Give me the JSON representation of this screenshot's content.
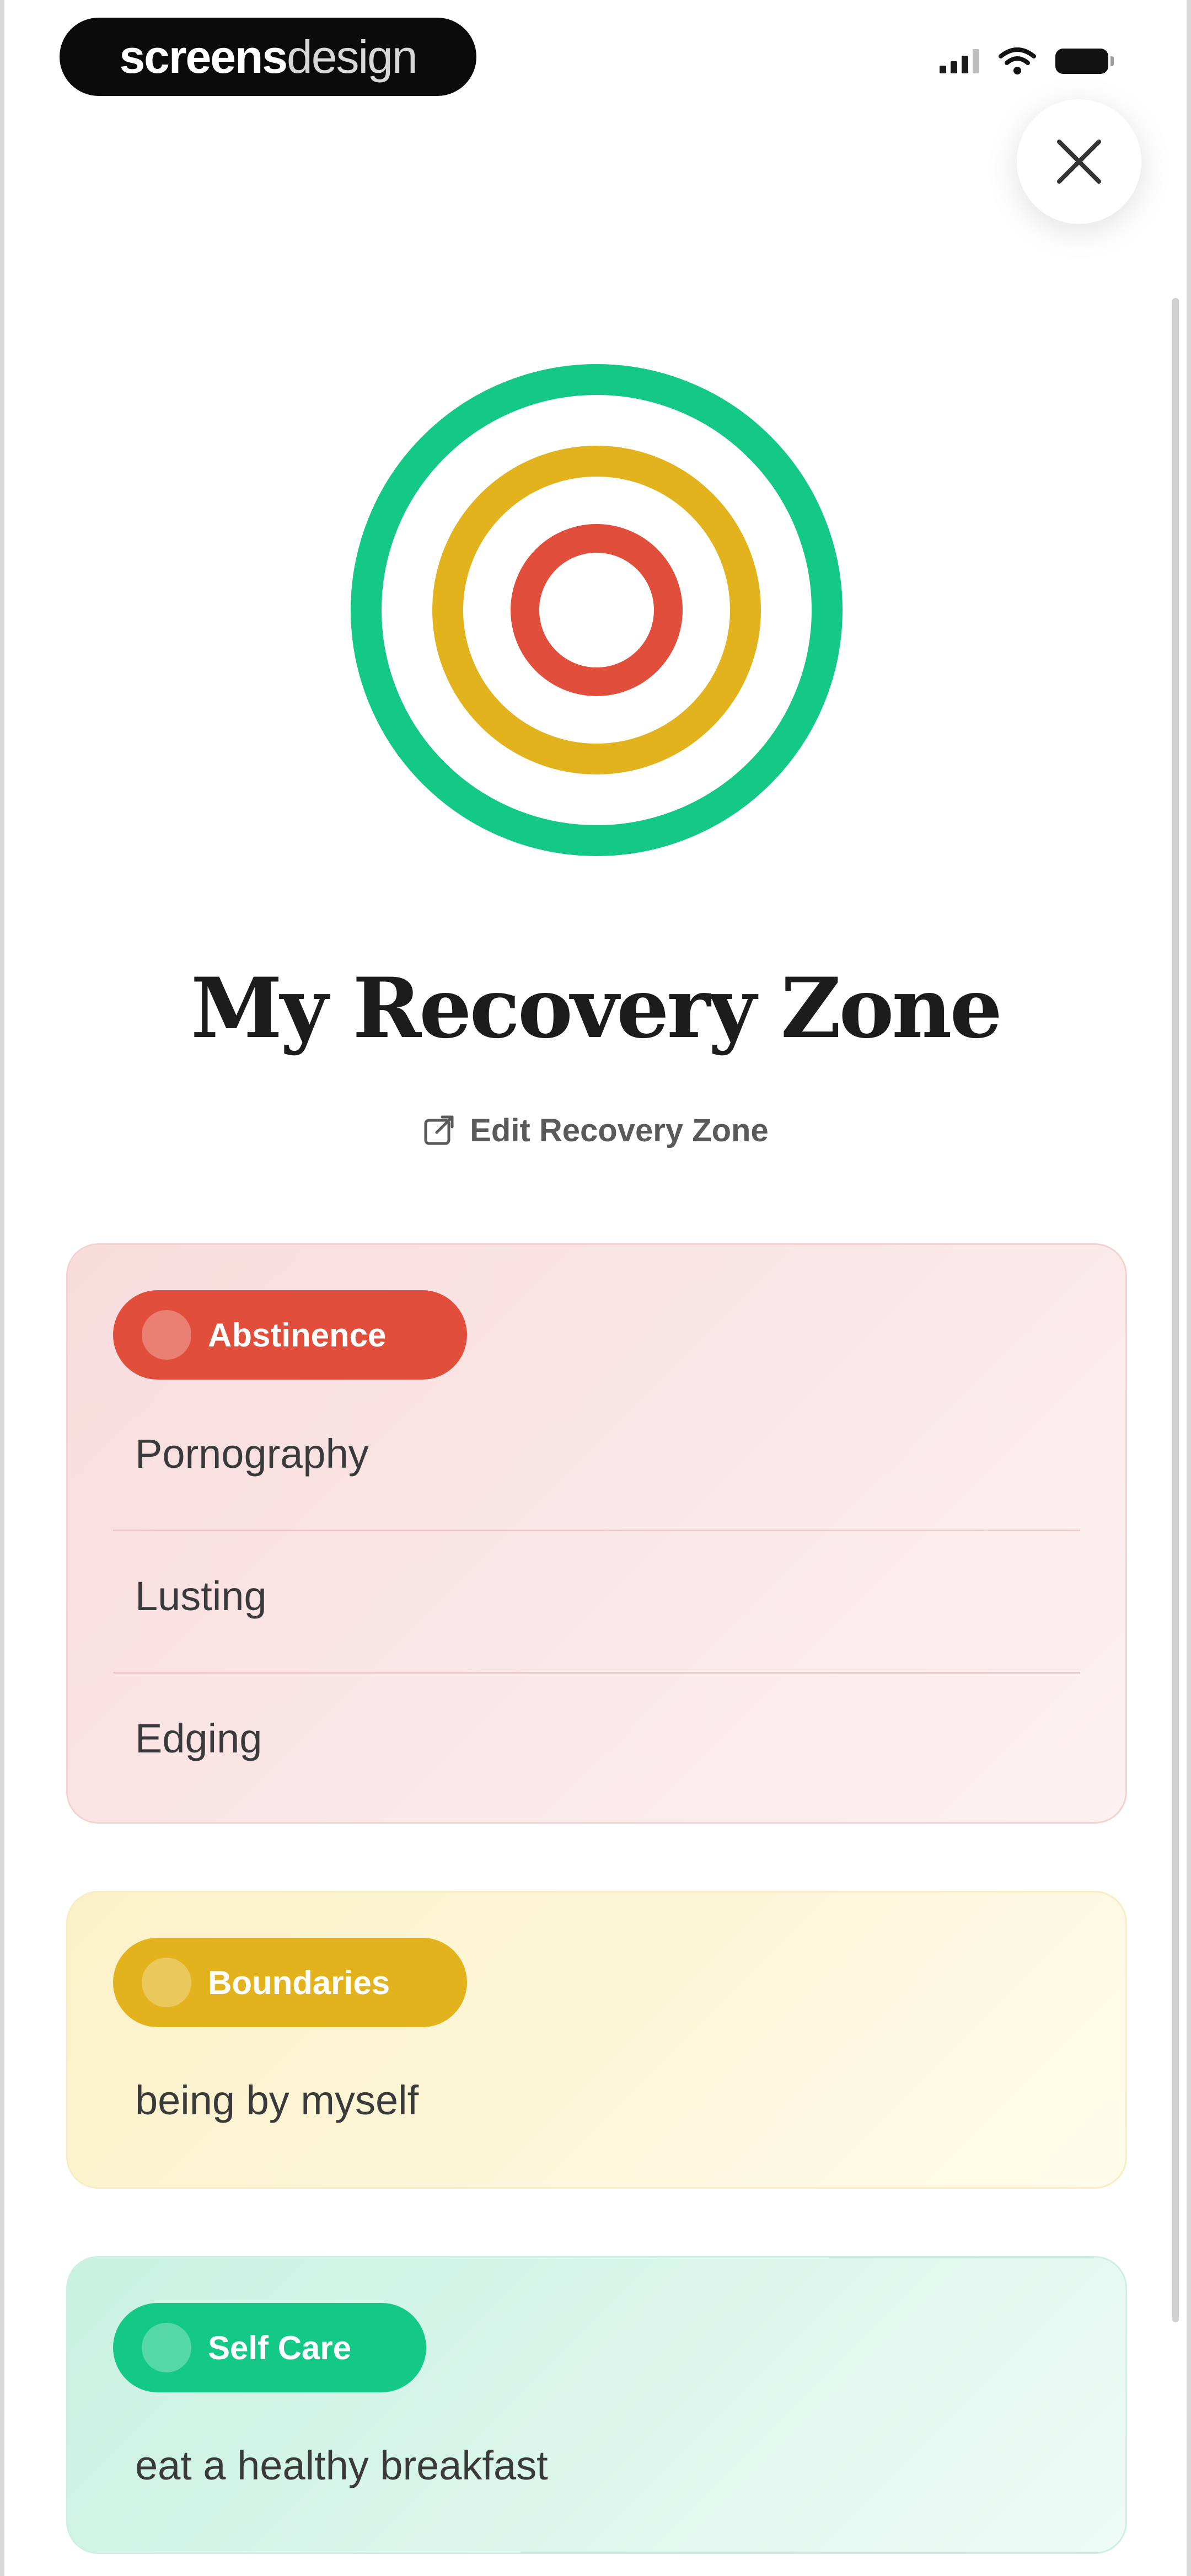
{
  "brand": {
    "part1": "screens",
    "part2": "design"
  },
  "colors": {
    "outer_ring": "#14c886",
    "middle_ring": "#e2b31d",
    "inner_ring": "#e14f3c"
  },
  "header": {
    "close_icon": "close-icon"
  },
  "title": "My Recovery Zone",
  "edit_link": "Edit Recovery Zone",
  "cards": {
    "abstinence": {
      "label": "Abstinence",
      "items": [
        "Pornography",
        "Lusting",
        "Edging"
      ]
    },
    "boundaries": {
      "label": "Boundaries",
      "items": [
        "being by myself"
      ]
    },
    "self_care": {
      "label": "Self Care",
      "items": [
        "eat a healthy breakfast"
      ]
    }
  }
}
